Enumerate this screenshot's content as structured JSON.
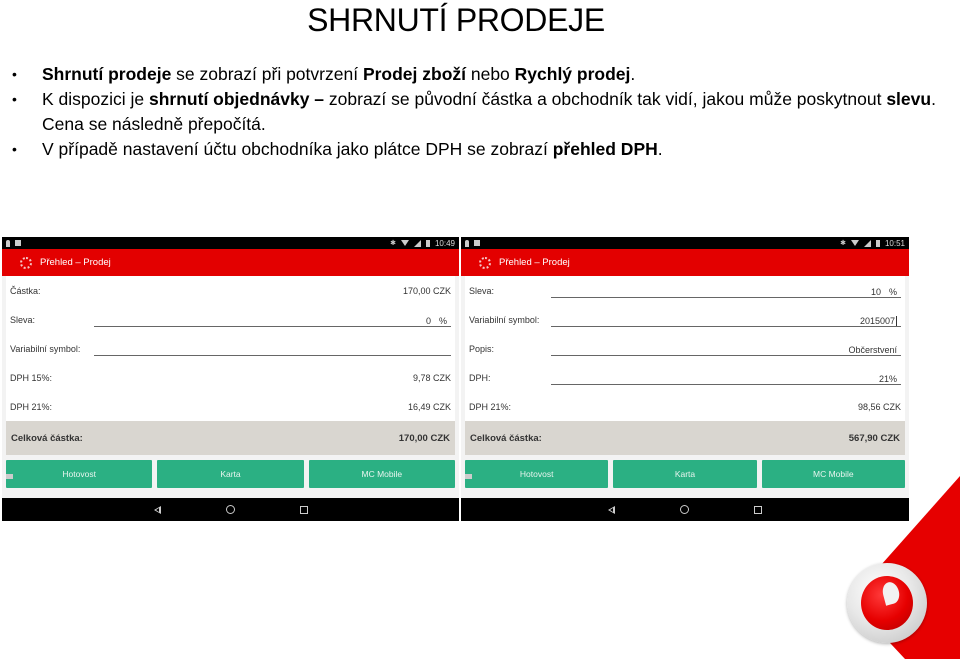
{
  "slide": {
    "title": "SHRNUTÍ PRODEJE",
    "bullets": [
      {
        "parts": [
          {
            "t": "Shrnutí  prodeje",
            "b": true
          },
          {
            "t": " se zobrazí při potvrzení ",
            "b": false
          },
          {
            "t": "Prodej zboží",
            "b": true
          },
          {
            "t": " nebo ",
            "b": false
          },
          {
            "t": "Rychlý prodej",
            "b": true
          },
          {
            "t": ".",
            "b": false
          }
        ]
      },
      {
        "parts": [
          {
            "t": "K dispozici je ",
            "b": false
          },
          {
            "t": "shrnutí objednávky –",
            "b": true
          },
          {
            "t": " zobrazí se původní částka a obchodník tak vidí, jakou může poskytnout ",
            "b": false
          },
          {
            "t": "slevu",
            "b": true
          },
          {
            "t": ". Cena se následně přepočítá.",
            "b": false
          }
        ]
      },
      {
        "parts": [
          {
            "t": "V případě nastavení účtu obchodníka jako plátce DPH se zobrazí ",
            "b": false
          },
          {
            "t": "přehled DPH",
            "b": true
          },
          {
            "t": ".",
            "b": false
          }
        ]
      }
    ]
  },
  "screens": {
    "left": {
      "status_time": "10:49",
      "app_title": "Přehled – Prodej",
      "rows": [
        {
          "label": "Částka:",
          "value": "170,00 CZK"
        },
        {
          "label": "Sleva:",
          "field_value": "0",
          "unit": "%"
        },
        {
          "label": "Variabilní symbol:",
          "field_value": ""
        },
        {
          "label": "DPH 15%:",
          "value": "9,78 CZK"
        },
        {
          "label": "DPH 21%:",
          "value": "16,49 CZK"
        }
      ],
      "total_label": "Celková částka:",
      "total_value": "170,00 CZK",
      "buttons": [
        "Hotovost",
        "Karta",
        "MC Mobile"
      ]
    },
    "right": {
      "status_time": "10:51",
      "app_title": "Přehled – Prodej",
      "rows": [
        {
          "label": "Sleva:",
          "field_value": "10",
          "unit": "%"
        },
        {
          "label": "Variabilní symbol:",
          "field_value": "2015007"
        },
        {
          "label": "Popis:",
          "field_value": "Občerstvení"
        },
        {
          "label": "DPH:",
          "field_value": "21%"
        },
        {
          "label": "DPH 21%:",
          "value": "98,56 CZK"
        }
      ],
      "total_label": "Celková částka:",
      "total_value": "567,90 CZK",
      "buttons": [
        "Hotovost",
        "Karta",
        "MC Mobile"
      ]
    }
  },
  "colors": {
    "appbar_red": "#e30000",
    "pay_button_green": "#2bb083",
    "total_bg": "#d9d6d0",
    "brand_red": "#e60000"
  }
}
